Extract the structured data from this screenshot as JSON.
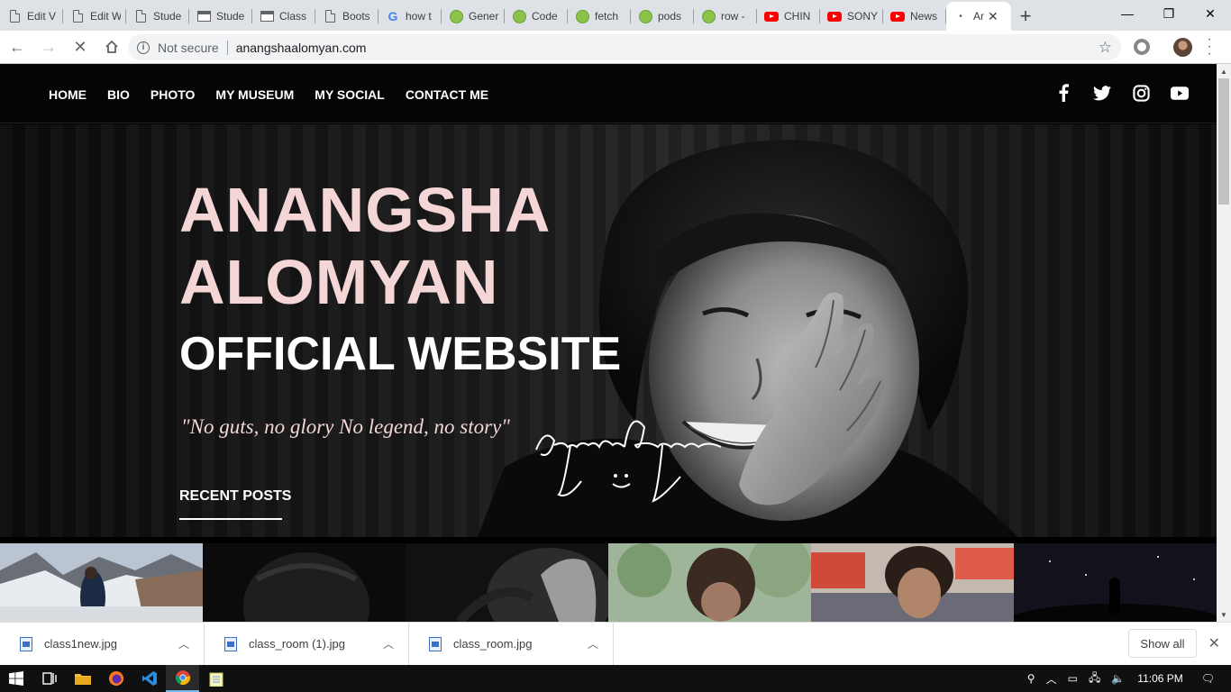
{
  "browser": {
    "tabs": [
      {
        "title": "Edit V",
        "icon": "doc-icon"
      },
      {
        "title": "Edit W",
        "icon": "doc-icon"
      },
      {
        "title": "Stude",
        "icon": "doc-icon"
      },
      {
        "title": "Stude",
        "icon": "classroom-icon"
      },
      {
        "title": "Class",
        "icon": "classroom-icon"
      },
      {
        "title": "Boots",
        "icon": "doc-icon"
      },
      {
        "title": "how t",
        "icon": "google-icon"
      },
      {
        "title": "Gener",
        "icon": "green-circle-icon"
      },
      {
        "title": "Code",
        "icon": "green-circle-icon"
      },
      {
        "title": "fetch",
        "icon": "green-circle-icon"
      },
      {
        "title": "pods",
        "icon": "green-circle-icon"
      },
      {
        "title": "row -",
        "icon": "green-circle-icon"
      },
      {
        "title": "CHIN",
        "icon": "youtube-icon"
      },
      {
        "title": "SONY",
        "icon": "youtube-icon"
      },
      {
        "title": "News",
        "icon": "youtube-icon"
      },
      {
        "title": "Ar",
        "icon": "loading-icon",
        "active": true
      }
    ],
    "new_tab": "+",
    "omnibox": {
      "security": "Not secure",
      "url": "anangshaalomyan.com"
    }
  },
  "site": {
    "nav": [
      "HOME",
      "BIO",
      "PHOTO",
      "MY MUSEUM",
      "MY SOCIAL",
      "CONTACT ME"
    ],
    "social_icons": [
      "facebook-icon",
      "twitter-icon",
      "instagram-icon",
      "youtube-icon"
    ],
    "hero": {
      "name_line1": "ANANGSHA",
      "name_line2": "ALOMYAN",
      "subtitle": "OFFICIAL WEBSITE",
      "quote": "\"No guts, no glory No legend, no story\"",
      "signature": "AnangshaAlomyan"
    },
    "recent_posts_label": "RECENT POSTS"
  },
  "downloads": {
    "items": [
      "class1new.jpg",
      "class_room (1).jpg",
      "class_room.jpg"
    ],
    "show_all": "Show all"
  },
  "taskbar": {
    "time": "11:06 PM"
  }
}
